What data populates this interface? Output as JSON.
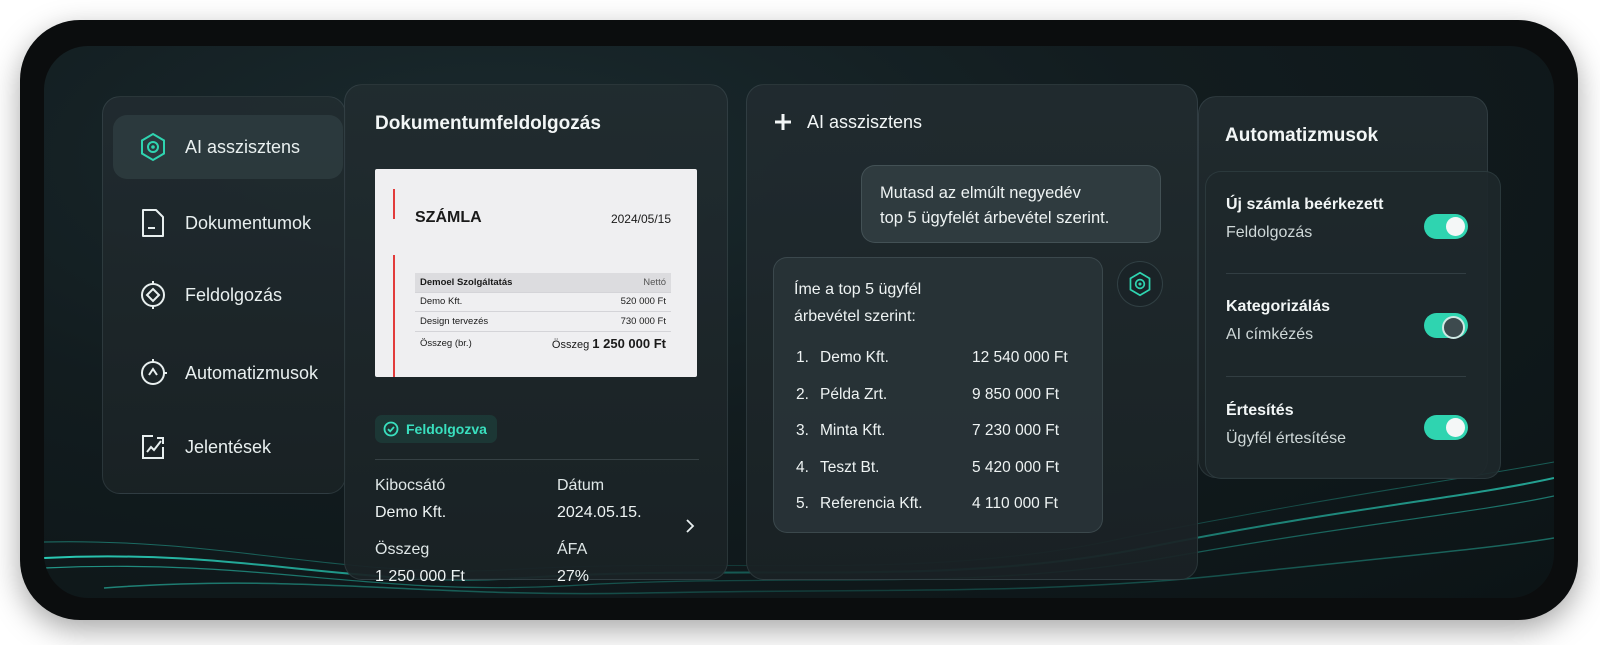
{
  "sidebar": {
    "items": [
      {
        "label": "AI asszisztens",
        "icon": "ai-assistant-icon",
        "active": true
      },
      {
        "label": "Dokumentumok",
        "icon": "document-icon",
        "active": false
      },
      {
        "label": "Feldolgozás",
        "icon": "processing-icon",
        "active": false
      },
      {
        "label": "Automatizmusok",
        "icon": "automation-icon",
        "active": false
      },
      {
        "label": "Jelentések",
        "icon": "reports-icon",
        "active": false
      }
    ]
  },
  "document_panel": {
    "title": "Dokumentumfeldolgozás",
    "invoice": {
      "title": "SZÁMLA",
      "date": "2024/05/15",
      "header": {
        "label": "Demoel Szolgáltatás",
        "value": "Nettó"
      },
      "rows": [
        {
          "label": "Demo Kft.",
          "value": "520 000 Ft"
        },
        {
          "label": "Design tervezés",
          "value": "730 000 Ft"
        }
      ],
      "total": {
        "label": "Összeg (br.)",
        "prefix": "Összeg",
        "value": "1 250 000 Ft"
      }
    },
    "status": "Feldolgozva",
    "fields": {
      "issuer_label": "Kibocsátó",
      "issuer_value": "Demo Kft.",
      "date_label": "Dátum",
      "date_value": "2024.05.15.",
      "amount_label": "Összeg",
      "amount_value": "1 250 000 Ft",
      "vat_label": "ÁFA",
      "vat_value": "27%"
    }
  },
  "ai_panel": {
    "title": "AI asszisztens",
    "user_message_line1": "Mutasd az elmúlt negyedév",
    "user_message_line2": "top 5 ügyfelét árbevétel szerint.",
    "reply_line1": "Íme a top 5 ügyfél",
    "reply_line2": "árbevétel szerint:",
    "ranking": [
      {
        "num": "1.",
        "name": "Demo Kft.",
        "value": "12 540 000 Ft"
      },
      {
        "num": "2.",
        "name": "Példa Zrt.",
        "value": "9 850 000 Ft"
      },
      {
        "num": "3.",
        "name": "Minta Kft.",
        "value": "7 230 000 Ft"
      },
      {
        "num": "4.",
        "name": "Teszt Bt.",
        "value": "5 420 000 Ft"
      },
      {
        "num": "5.",
        "name": "Referencia Kft.",
        "value": "4 110 000 Ft"
      }
    ]
  },
  "automations_panel": {
    "title": "Automatizmusok",
    "items": [
      {
        "title": "Új számla beérkezett",
        "subtitle": "Feldolgozás",
        "enabled": true
      },
      {
        "title": "Kategorizálás",
        "subtitle": "AI címkézés",
        "enabled": true
      },
      {
        "title": "Értesítés",
        "subtitle": "Ügyfél értesítése",
        "enabled": true
      }
    ]
  },
  "colors": {
    "accent": "#2fd4b0",
    "invoice_accent": "#e23b3b",
    "background": "#121c1f"
  }
}
